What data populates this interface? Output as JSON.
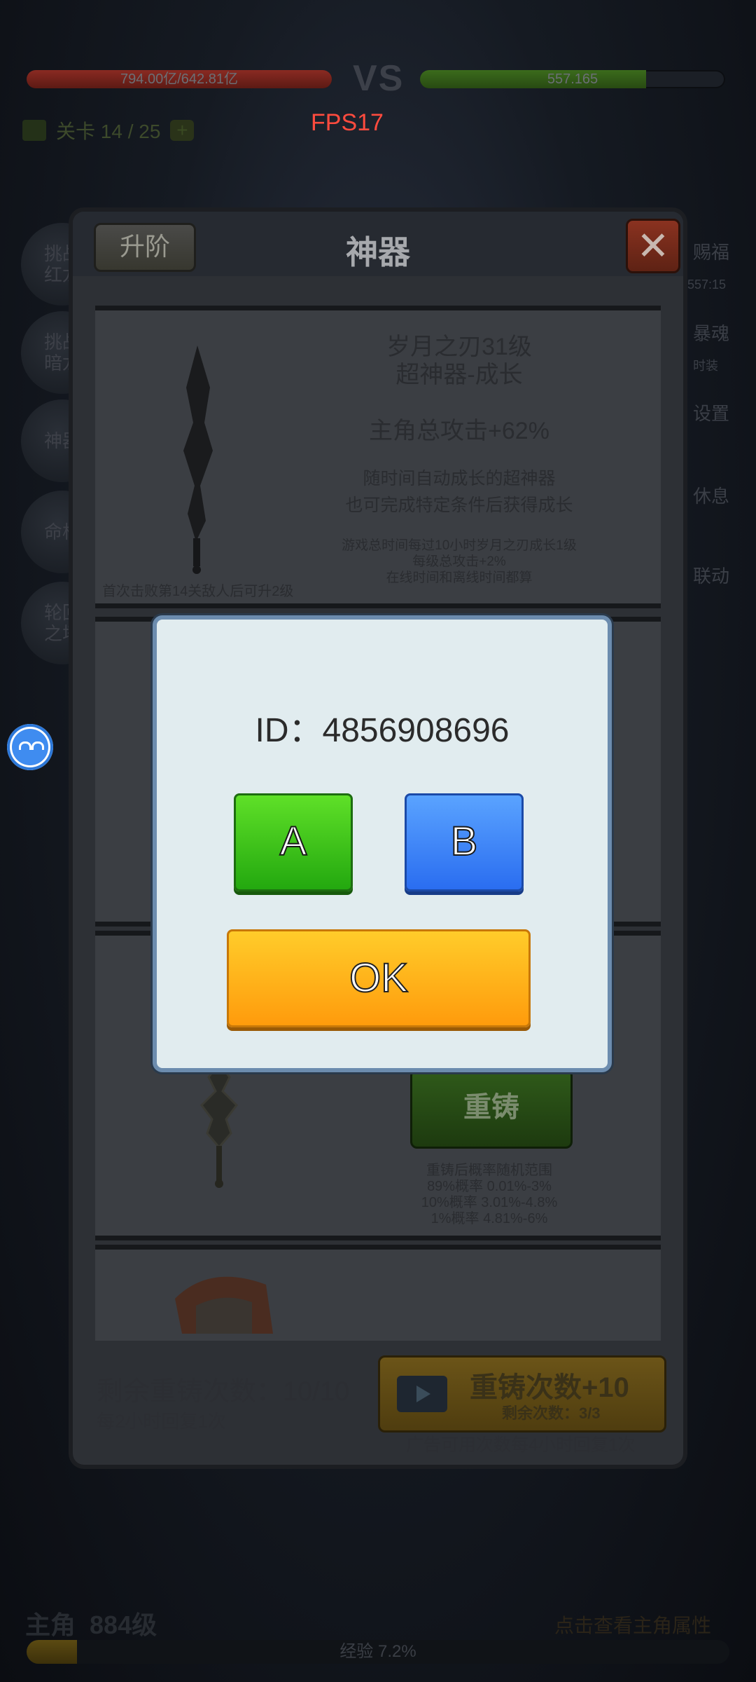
{
  "hud": {
    "enemy_hp": "794.00亿/642.81亿",
    "vs": "VS",
    "player_hp": "557.165",
    "fps": "FPS17",
    "stage": "关卡 14 / 25",
    "stage_plus": "+"
  },
  "left_menu": [
    {
      "label": "挑战\n红龙"
    },
    {
      "label": "挑战\n暗龙"
    },
    {
      "label": "神器"
    },
    {
      "label": "命格"
    },
    {
      "label": "轮回\n之塔"
    }
  ],
  "right_menu": [
    {
      "label": "赐福"
    },
    {
      "label": "557:15"
    },
    {
      "label": "暴魂"
    },
    {
      "label": "时装"
    },
    {
      "label": "设置"
    },
    {
      "label": "休息"
    },
    {
      "label": "联动"
    }
  ],
  "bottom": {
    "hero_name": "主角",
    "hero_level": "884级",
    "right_hint": "点击查看主角属性",
    "xp_text": "经验 7.2%",
    "xp_progress": 0.072
  },
  "panel": {
    "upgrade_label": "升阶",
    "title": "神器",
    "close_label": "✕",
    "card1": {
      "name_line1": "岁月之刃31级",
      "name_line2": "超神器-成长",
      "stat": "主角总攻击+62%",
      "desc1": "随时间自动成长的超神器",
      "desc2": "也可完成特定条件后获得成长",
      "note1": "游戏总时间每过10小时岁月之刃成长1级",
      "note2": "每级总攻击+2%",
      "note3": "在线时间和离线时间都算",
      "unlock": "首次击败第14关敌人后可升2级"
    },
    "card3": {
      "reforge_label": "重铸",
      "range_title": "重铸后概率随机范围",
      "range1": "89%概率 0.01%-3%",
      "range2": "10%概率 3.01%-4.8%",
      "range3": "1%概率 4.81%-6%"
    },
    "remaining": "剩余重铸次数：10/10",
    "recover": "每2小时回复1次",
    "ad_title": "重铸次数+10",
    "ad_sub": "剩余次数：3/3",
    "ad_note": "广告可用次数每4小时回复1次"
  },
  "modal": {
    "id_text": "ID：4856908696",
    "option_a": "A",
    "option_b": "B",
    "ok_label": "OK"
  }
}
